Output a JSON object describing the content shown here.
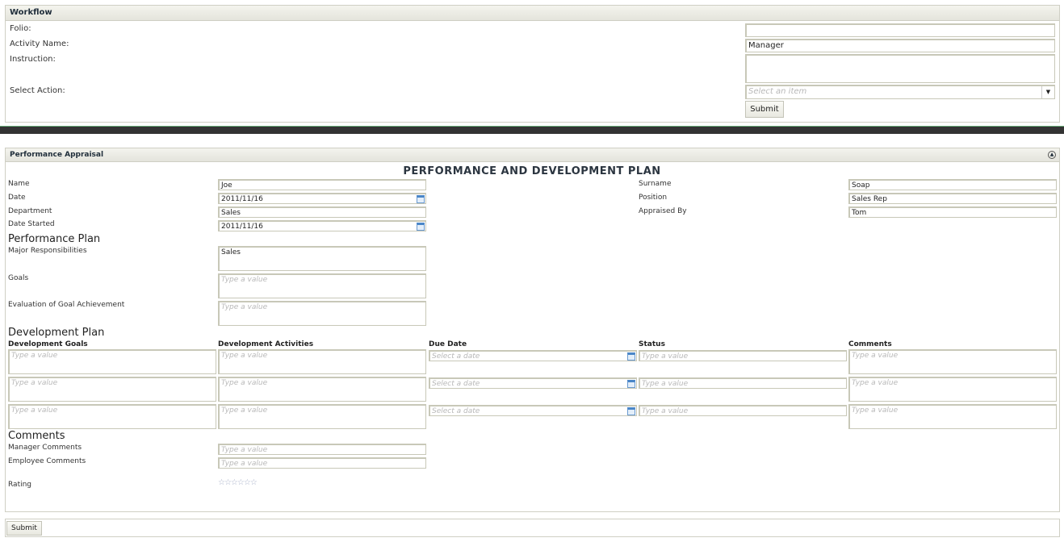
{
  "workflow": {
    "title": "Workflow",
    "folio_label": "Folio:",
    "folio_value": "",
    "activity_label": "Activity Name:",
    "activity_value": "Manager",
    "instruction_label": "Instruction:",
    "instruction_value": "",
    "action_label": "Select Action:",
    "action_placeholder": "Select an item",
    "submit": "Submit"
  },
  "appraisal": {
    "title": "Performance Appraisal",
    "heading": "PERFORMANCE AND DEVELOPMENT PLAN",
    "name_label": "Name",
    "name": "Joe",
    "date_label": "Date",
    "date": "2011/11/16",
    "department_label": "Department",
    "department": "Sales",
    "date_started_label": "Date Started",
    "date_started": "2011/11/16",
    "surname_label": "Surname",
    "surname": "Soap",
    "position_label": "Position",
    "position": "Sales Rep",
    "appraised_by_label": "Appraised By",
    "appraised_by": "Tom",
    "perf_plan_heading": "Performance Plan",
    "responsibilities_label": "Major Responsibilities",
    "responsibilities": "Sales",
    "goals_label": "Goals",
    "evaluation_label": "Evaluation of Goal Achievement",
    "dev_plan_heading": "Development Plan",
    "columns": [
      "Development Goals",
      "Development Activities",
      "Due Date",
      "Status",
      "Comments"
    ],
    "comments_heading": "Comments",
    "manager_comments_label": "Manager Comments",
    "employee_comments_label": "Employee Comments",
    "rating_label": "Rating",
    "rating": 0,
    "rating_max": 6,
    "stars": "☆☆☆☆☆☆",
    "placeholder": "Type a value",
    "date_placeholder": "Select a date"
  },
  "footer": {
    "submit": "Submit"
  }
}
